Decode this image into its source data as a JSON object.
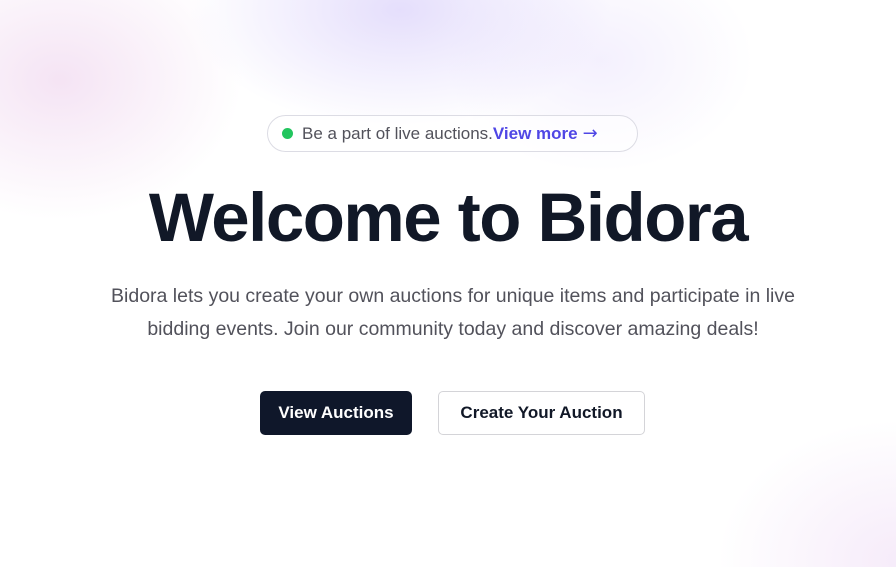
{
  "announcement": {
    "text": "Be a part of live auctions.",
    "link_label": "View more",
    "arrow_icon": "→",
    "status_color": "#22c55e",
    "link_color": "#4f46e5"
  },
  "hero": {
    "title": "Welcome to Bidora",
    "description": "Bidora lets you create your own auctions for unique items and participate in live bidding events. Join our community today and discover amazing deals!"
  },
  "actions": {
    "primary_label": "View Auctions",
    "secondary_label": "Create Your Auction",
    "primary_color": "#0f172a"
  }
}
